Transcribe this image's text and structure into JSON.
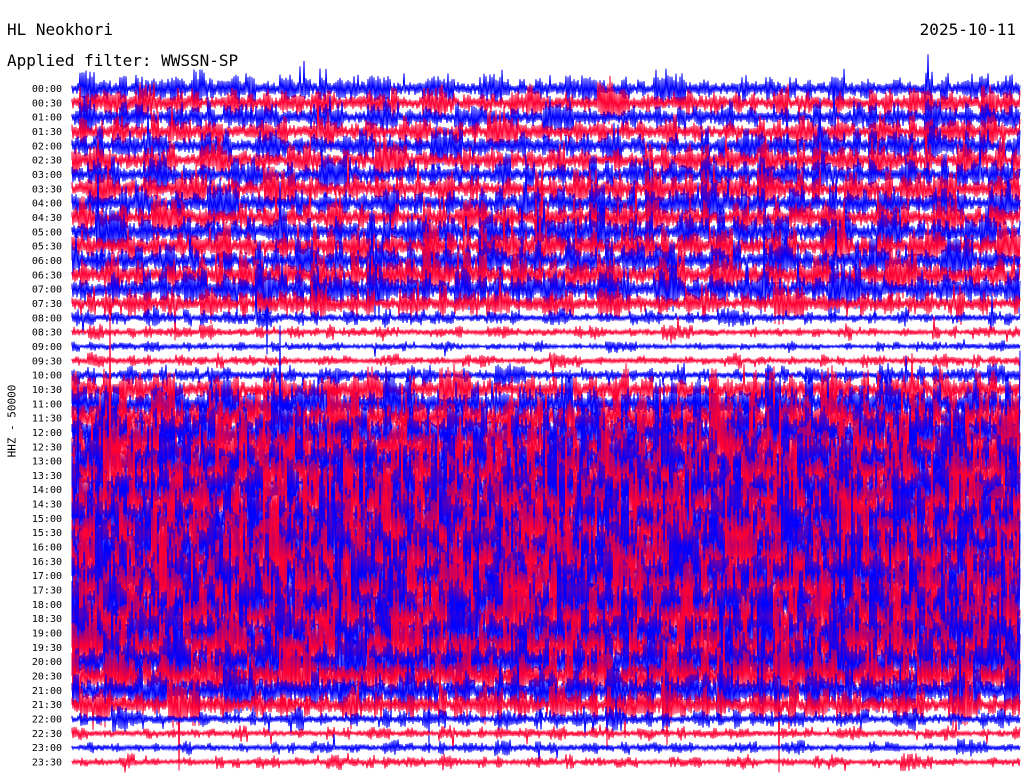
{
  "header": {
    "station": "HL Neokhori",
    "date": "2025-10-11",
    "filter": "Applied filter: WWSSN-SP"
  },
  "chart_data": {
    "type": "line",
    "title": "HL Neokhori",
    "subtitle": "Applied filter: WWSSN-SP",
    "date": "2025-10-11",
    "ylabel": "HHZ - 50000",
    "time_labels": [
      "00:00",
      "00:30",
      "01:00",
      "01:30",
      "02:00",
      "02:30",
      "03:00",
      "03:30",
      "04:00",
      "04:30",
      "05:00",
      "05:30",
      "06:00",
      "06:30",
      "07:00",
      "07:30",
      "08:00",
      "08:30",
      "09:00",
      "09:30",
      "10:00",
      "10:30",
      "11:00",
      "11:30",
      "12:00",
      "12:30",
      "13:00",
      "13:30",
      "14:00",
      "14:30",
      "15:00",
      "15:30",
      "16:00",
      "16:30",
      "17:00",
      "17:30",
      "18:00",
      "18:30",
      "19:00",
      "19:30",
      "20:00",
      "20:30",
      "21:00",
      "21:30",
      "22:00",
      "22:30",
      "23:00",
      "23:30"
    ],
    "line_colors": [
      "#0000ff",
      "#ff0033"
    ],
    "line_amplitude": [
      1.0,
      1.0,
      1.0,
      1.0,
      1.1,
      1.1,
      1.1,
      1.2,
      1.2,
      1.2,
      1.3,
      1.3,
      1.3,
      1.4,
      1.4,
      1.0,
      0.5,
      0.4,
      0.3,
      0.4,
      0.6,
      1.2,
      1.6,
      2.0,
      2.3,
      2.5,
      2.6,
      2.7,
      2.8,
      2.8,
      2.9,
      2.9,
      3.0,
      3.0,
      3.0,
      2.9,
      2.9,
      2.8,
      2.7,
      2.6,
      2.4,
      2.0,
      1.6,
      1.2,
      0.6,
      0.4,
      0.4,
      0.4
    ],
    "background": "#ffffff"
  }
}
